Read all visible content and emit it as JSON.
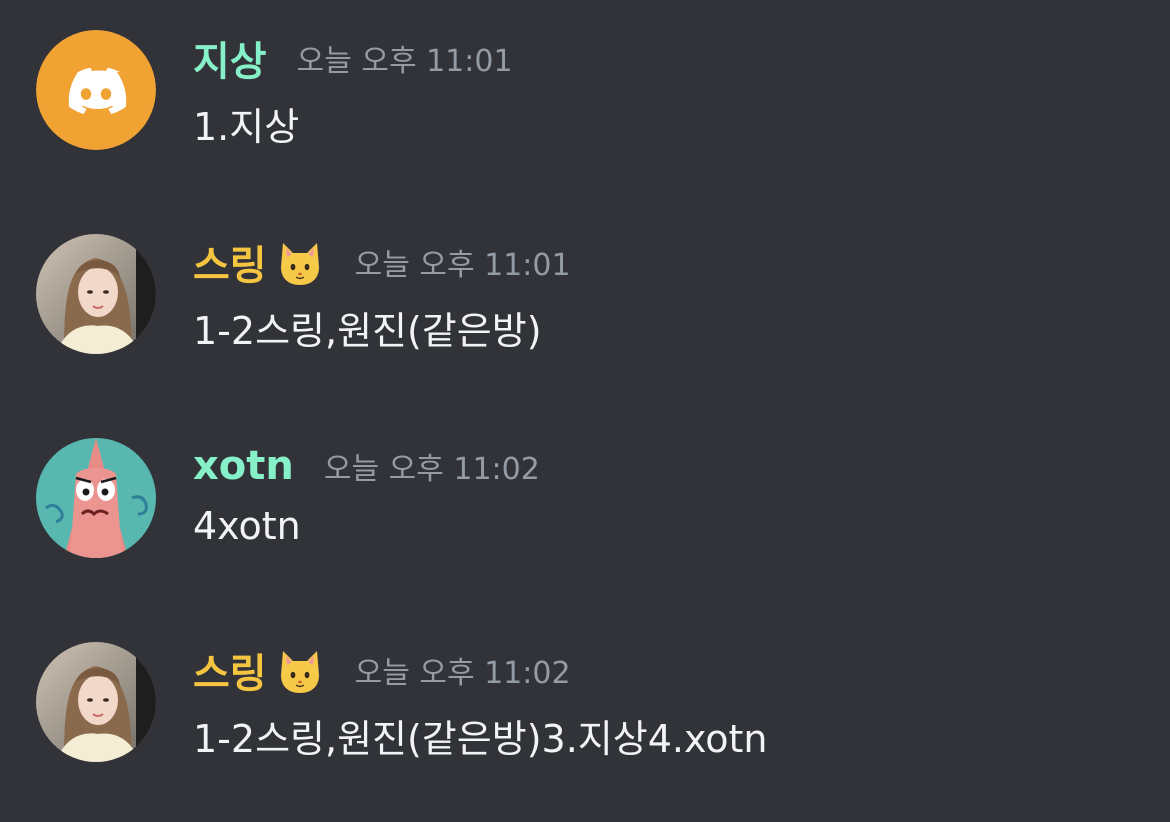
{
  "messages": [
    {
      "username": "지상",
      "username_color": "#86f0c8",
      "timestamp": "오늘 오후 11:01",
      "content": "1.지상",
      "avatar_icon": "discord-logo-icon",
      "avatar_color": "#f0a232"
    },
    {
      "username": "스링",
      "username_color": "#f5c542",
      "badge_icon": "cat-face-icon",
      "timestamp": "오늘 오후 11:01",
      "content": "1-2스링,원진(같은방)",
      "avatar_icon": "user-photo-avatar"
    },
    {
      "username": "xotn",
      "username_color": "#86f0c8",
      "timestamp": "오늘 오후 11:02",
      "content": "4xotn",
      "avatar_icon": "patrick-star-avatar"
    },
    {
      "username": "스링",
      "username_color": "#f5c542",
      "badge_icon": "cat-face-icon",
      "timestamp": "오늘 오후 11:02",
      "content": "1-2스링,원진(같은방)3.지상4.xotn",
      "avatar_icon": "user-photo-avatar"
    }
  ]
}
